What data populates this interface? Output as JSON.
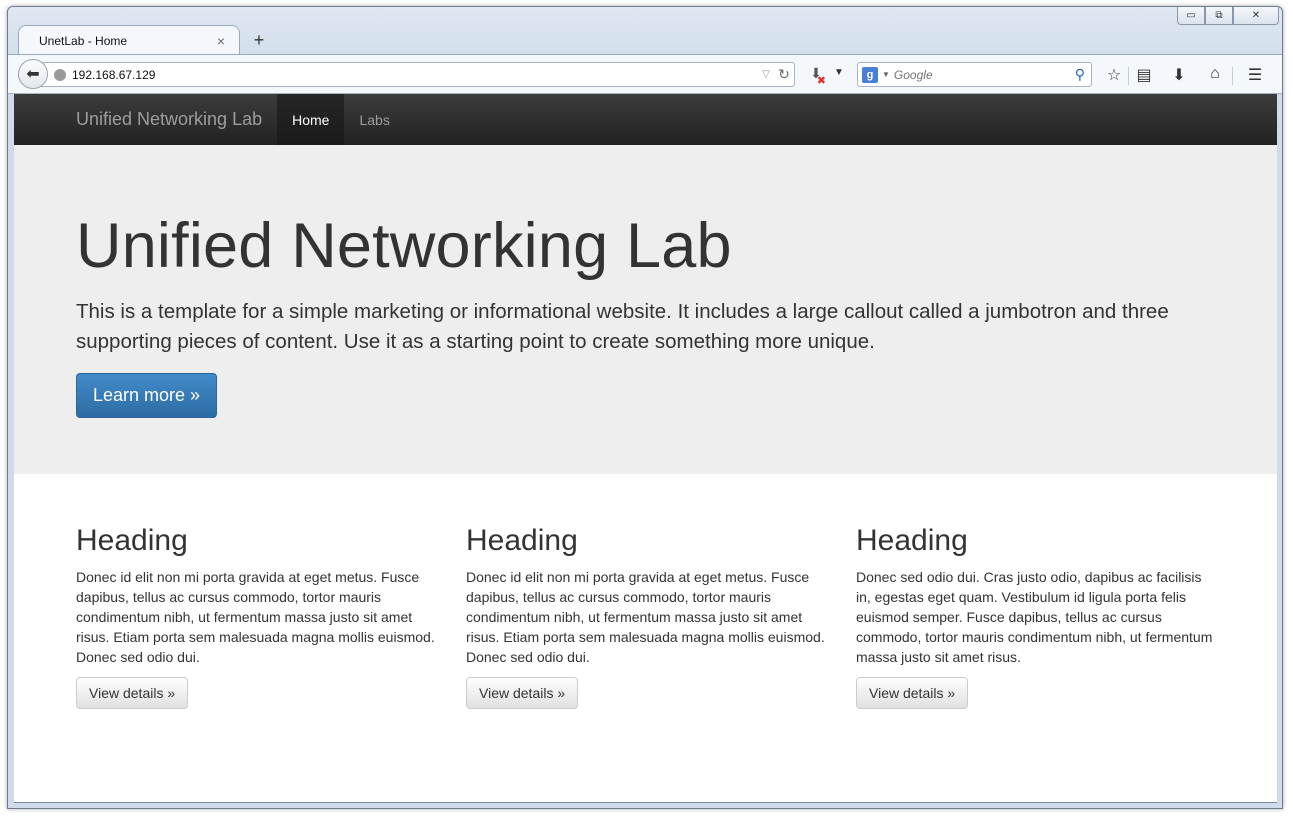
{
  "browser": {
    "tab_title": "UnetLab - Home",
    "tab_close": "×",
    "new_tab": "+",
    "url": "192.168.67.129",
    "search_placeholder": "Google",
    "search_engine_letter": "g",
    "window_controls": {
      "minimize": "▭",
      "restore": "⧉",
      "close": "✕"
    }
  },
  "site": {
    "brand": "Unified Networking Lab",
    "nav": [
      {
        "label": "Home",
        "active": true
      },
      {
        "label": "Labs",
        "active": false
      }
    ]
  },
  "jumbotron": {
    "title": "Unified Networking Lab",
    "text": "This is a template for a simple marketing or informational website. It includes a large callout called a jumbotron and three supporting pieces of content. Use it as a starting point to create something more unique.",
    "button": "Learn more »"
  },
  "columns": [
    {
      "heading": "Heading",
      "text": "Donec id elit non mi porta gravida at eget metus. Fusce dapibus, tellus ac cursus commodo, tortor mauris condimentum nibh, ut fermentum massa justo sit amet risus. Etiam porta sem malesuada magna mollis euismod. Donec sed odio dui.",
      "button": "View details »"
    },
    {
      "heading": "Heading",
      "text": "Donec id elit non mi porta gravida at eget metus. Fusce dapibus, tellus ac cursus commodo, tortor mauris condimentum nibh, ut fermentum massa justo sit amet risus. Etiam porta sem malesuada magna mollis euismod. Donec sed odio dui.",
      "button": "View details »"
    },
    {
      "heading": "Heading",
      "text": "Donec sed odio dui. Cras justo odio, dapibus ac facilisis in, egestas eget quam. Vestibulum id ligula porta felis euismod semper. Fusce dapibus, tellus ac cursus commodo, tortor mauris condimentum nibh, ut fermentum massa justo sit amet risus.",
      "button": "View details »"
    }
  ],
  "colors": {
    "navbar": "#222222",
    "jumbotron_bg": "#eeeeee",
    "primary": "#428bca",
    "text": "#333333"
  },
  "icons": [
    "back-arrow-icon",
    "globe-icon",
    "reload-icon",
    "download-blocked-icon",
    "search-icon",
    "bookmark-star-icon",
    "clipboard-icon",
    "download-icon",
    "home-icon",
    "menu-icon"
  ]
}
